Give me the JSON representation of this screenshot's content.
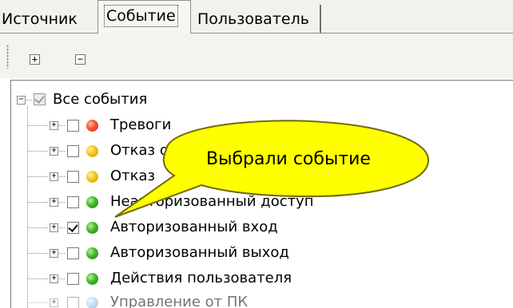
{
  "tabs": [
    {
      "label": "Источник"
    },
    {
      "label": "Событие"
    },
    {
      "label": "Пользователь"
    }
  ],
  "toolbar": {
    "expand_symbol": "+",
    "collapse_symbol": "−"
  },
  "tree": {
    "root": {
      "label": "Все события",
      "checked": true,
      "expander": "−"
    },
    "items": [
      {
        "label": "Тревоги",
        "checked": false,
        "color": "red"
      },
      {
        "label": "Отказ оборудования",
        "checked": false,
        "color": "yellow"
      },
      {
        "label": "Отказ",
        "checked": false,
        "color": "yellow"
      },
      {
        "label": "Неавторизованный доступ",
        "checked": false,
        "color": "green"
      },
      {
        "label": "Авторизованный вход",
        "checked": true,
        "color": "green"
      },
      {
        "label": "Авторизованный выход",
        "checked": false,
        "color": "green"
      },
      {
        "label": "Действия пользователя",
        "checked": false,
        "color": "green"
      },
      {
        "label": "Управление от ПК",
        "checked": false,
        "color": "blue"
      }
    ],
    "expander_symbol": "+"
  },
  "callout": {
    "text": "Выбрали событие"
  },
  "colors": {
    "red": "#f3522b",
    "yellow": "#f4c517",
    "green": "#3fb82a",
    "blue": "#8dc7f4",
    "callout_fill": "#ffff00"
  }
}
